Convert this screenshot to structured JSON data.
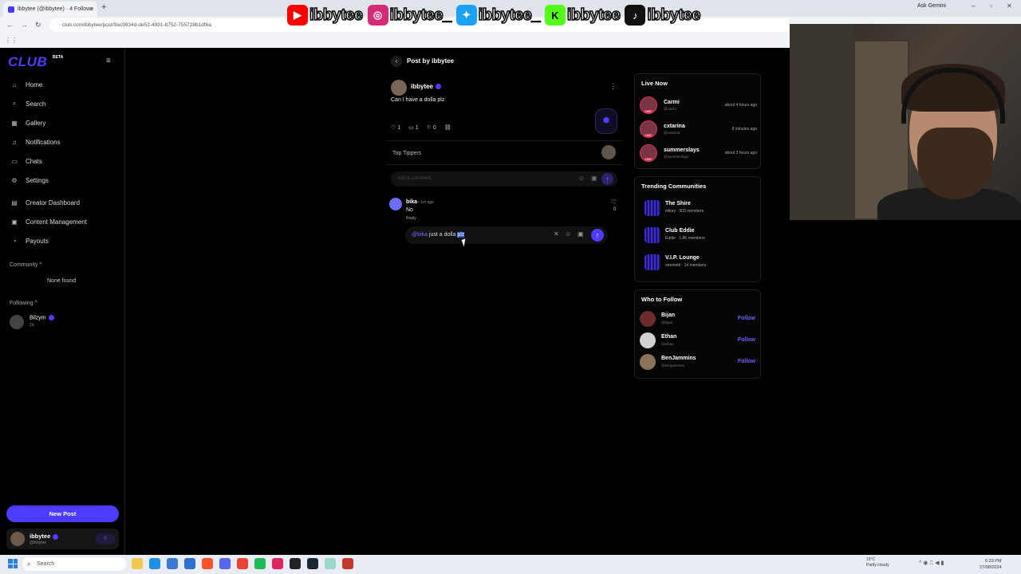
{
  "browser": {
    "tab_title": "ibbytee (@ibbytee) · 4 Followe",
    "tab_close": "×",
    "new_tab": "+",
    "url": "club.com/ibbytee/post/9ac9934d-de52-4991-b752-755728b1df6a",
    "ask_gemini": "Ask Gemini"
  },
  "overlay": {
    "handles": [
      "ibbytee",
      "ibbytee_",
      "ibbytee_",
      "ibbytee",
      "ibbytee"
    ],
    "icons": [
      "youtube-icon",
      "instagram-icon",
      "twitter-icon",
      "kick-icon",
      "tiktok-icon"
    ],
    "colors": [
      "#ff0000",
      "#d62976",
      "#1da1f2",
      "#53fc18",
      "#111111"
    ]
  },
  "sidebar": {
    "logo": "CLUB",
    "logo_badge": "BETA",
    "nav": [
      {
        "label": "Home",
        "icon": "home-icon"
      },
      {
        "label": "Search",
        "icon": "search-icon"
      },
      {
        "label": "Gallery",
        "icon": "gallery-icon"
      },
      {
        "label": "Notifications",
        "icon": "bell-icon"
      },
      {
        "label": "Chats",
        "icon": "chat-icon"
      },
      {
        "label": "Settings",
        "icon": "gear-icon"
      },
      {
        "label": "Creator Dashboard",
        "icon": "dashboard-icon"
      },
      {
        "label": "Content Management",
        "icon": "content-icon"
      },
      {
        "label": "Payouts",
        "icon": "payouts-icon"
      }
    ],
    "community_label": "Community",
    "community_empty": "None found",
    "following_label": "Following",
    "following": [
      {
        "name": "Bilzym",
        "sub": "2d"
      }
    ],
    "new_post": "New Post",
    "me": {
      "name": "ibbytee",
      "handle": "@ibbytee",
      "badge": "0"
    }
  },
  "post": {
    "header": "Post by ibbytee",
    "author": "ibbytee",
    "text": "Can I have a dolla plz",
    "likes": "1",
    "comments": "1",
    "bookmarks": "0",
    "top_tippers_label": "Top Tippers",
    "comment_placeholder": "Add a comment...",
    "comment": {
      "author": "bika",
      "time": "• 1m ago",
      "text": "No",
      "reply_label": "Reply",
      "likes": "0"
    },
    "reply": {
      "mention": "@bika",
      "text_plain": "just a dolla",
      "text_selected": "plz"
    }
  },
  "right": {
    "live_title": "Live Now",
    "live_tag": "LIVE",
    "live": [
      {
        "name": "Carmi",
        "handle": "@carmi",
        "time": "about 4 hours ago"
      },
      {
        "name": "cxtarina",
        "handle": "@cxtarina",
        "time": "8 minutes ago"
      },
      {
        "name": "summerslays",
        "handle": "@summerslays",
        "time": "about 3 hours ago"
      }
    ],
    "trending_title": "Trending Communities",
    "communities": [
      {
        "name": "The Shire",
        "sub": "mikey · 503 members"
      },
      {
        "name": "Club Eddie",
        "sub": "Eddie · 1.8K members"
      },
      {
        "name": "V.I.P. Lounge",
        "sub": "xtremetk · 14 members"
      }
    ],
    "wtf_title": "Who to Follow",
    "follow_label": "Follow",
    "wtf": [
      {
        "name": "Bijan",
        "handle": "@bijan"
      },
      {
        "name": "Ethan",
        "handle": "@ethan"
      },
      {
        "name": "BenJammins",
        "handle": "@benjammins"
      }
    ]
  },
  "taskbar": {
    "search": "Search",
    "temp": "15°C",
    "weather": "Partly cloudy",
    "time": "6:29 PM",
    "date": "27/08/2024"
  }
}
